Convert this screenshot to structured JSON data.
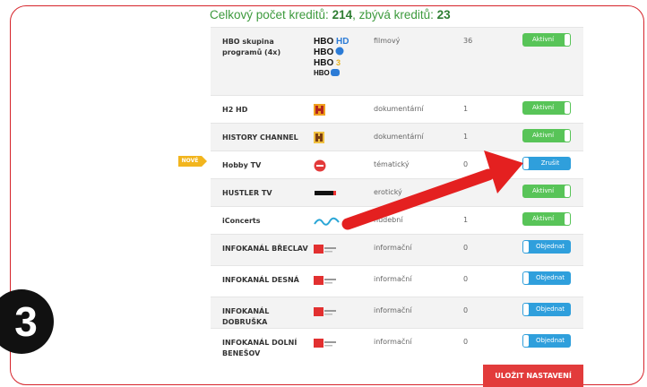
{
  "header": {
    "prefix": "Celkový počet kreditů:",
    "total": "214",
    "middle": ", zbývá kreditů:",
    "remaining": "23"
  },
  "badge_new": "NOVÉ",
  "step_number": "3",
  "save_label": "ULOŽIT NASTAVENÍ",
  "colors": {
    "active": "#58c458",
    "order": "#2f9fdc",
    "save": "#e23b3b",
    "badge": "#f2b51e",
    "arrow": "#e42020"
  },
  "channels": [
    {
      "name": "HBO skupina programů (4x)",
      "logo": "hbo-logo-icon",
      "genre": "filmový",
      "count": "36",
      "button": "Aktivní",
      "state": "active"
    },
    {
      "name": "H2 HD",
      "logo": "h2-logo-icon",
      "genre": "dokumentární",
      "count": "1",
      "button": "Aktivní",
      "state": "active"
    },
    {
      "name": "HISTORY CHANNEL",
      "logo": "history-logo-icon",
      "genre": "dokumentární",
      "count": "1",
      "button": "Aktivní",
      "state": "active"
    },
    {
      "name": "Hobby TV",
      "logo": "hobbytv-logo-icon",
      "genre": "tématický",
      "count": "0",
      "button": "Zrušit",
      "state": "cancel"
    },
    {
      "name": "HUSTLER TV",
      "logo": "hustler-logo-icon",
      "genre": "erotický",
      "count": "",
      "button": "Aktivní",
      "state": "active"
    },
    {
      "name": "iConcerts",
      "logo": "iconcerts-logo-icon",
      "genre": "hudební",
      "count": "1",
      "button": "Aktivní",
      "state": "active"
    },
    {
      "name": "INFOKANÁL BŘECLAV",
      "logo": "infokanal-logo-icon",
      "genre": "informační",
      "count": "0",
      "button": "Objednat",
      "state": "order"
    },
    {
      "name": "INFOKANÁL DESNÁ",
      "logo": "infokanal-logo-icon",
      "genre": "informační",
      "count": "0",
      "button": "Objednat",
      "state": "order"
    },
    {
      "name": "INFOKANÁL DOBRUŠKA",
      "logo": "infokanal-logo-icon",
      "genre": "informační",
      "count": "0",
      "button": "Objednat",
      "state": "order"
    },
    {
      "name": "INFOKANÁL DOLNÍ BENEŠOV",
      "logo": "infokanal-logo-icon",
      "genre": "informační",
      "count": "0",
      "button": "Objednat",
      "state": "order"
    }
  ]
}
